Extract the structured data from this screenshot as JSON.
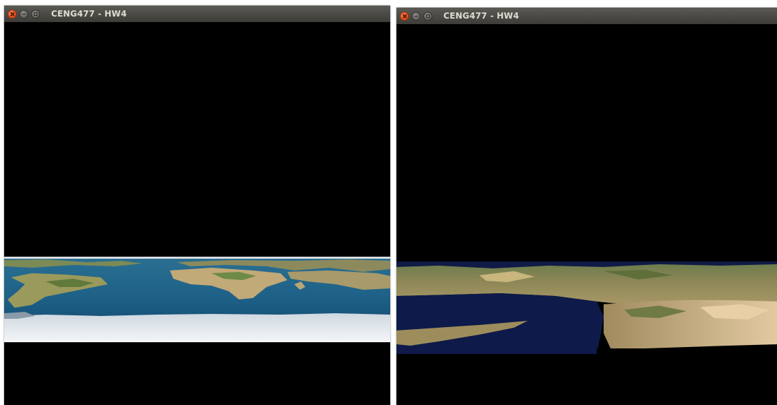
{
  "windows": [
    {
      "title": "CENG477 - HW4",
      "scene": "flat-world-map-terrain"
    },
    {
      "title": "CENG477 - HW4",
      "scene": "close-up-terrain"
    }
  ],
  "icons": {
    "close": "close-icon",
    "minimize": "minimize-icon",
    "maximize": "maximize-icon"
  },
  "colors": {
    "titlebar": "#3d3c38",
    "close": "#df4a16",
    "background": "#000000",
    "ocean": "#1d5f86",
    "deep_ocean": "#0e1a4a",
    "land": "#b5a070",
    "ice": "#e7ecf1"
  }
}
